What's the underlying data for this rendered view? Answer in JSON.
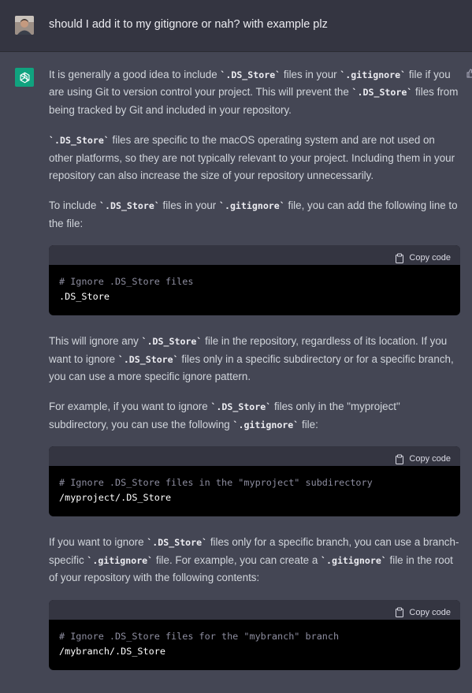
{
  "user": {
    "avatar_icon": "user-avatar",
    "message": "should I add it to my gitignore or nah? with example plz"
  },
  "assistant": {
    "logo_icon": "openai-logo",
    "p1": {
      "a": "It is generally a good idea to include ",
      "c1": "`.DS_Store`",
      "b": " files in your ",
      "c2": "`.gitignore`",
      "c": " file if you are using Git to version control your project. This will prevent the ",
      "c3": "`.DS_Store`",
      "d": " files from being tracked by Git and included in your repository."
    },
    "p2": {
      "c1": "`.DS_Store`",
      "a": " files are specific to the macOS operating system and are not used on other platforms, so they are not typically relevant to your project. Including them in your repository can also increase the size of your repository unnecessarily."
    },
    "p3": {
      "a": "To include ",
      "c1": "`.DS_Store`",
      "b": " files in your ",
      "c2": "`.gitignore`",
      "c": " file, you can add the following line to the file:"
    },
    "code1": {
      "copy_label": "Copy code",
      "comment": "# Ignore .DS_Store files",
      "line": ".DS_Store"
    },
    "p4": {
      "a": "This will ignore any ",
      "c1": "`.DS_Store`",
      "b": " file in the repository, regardless of its location. If you want to ignore ",
      "c2": "`.DS_Store`",
      "c": " files only in a specific subdirectory or for a specific branch, you can use a more specific ignore pattern."
    },
    "p5": {
      "a": "For example, if you want to ignore ",
      "c1": "`.DS_Store`",
      "b": " files only in the \"myproject\" subdirectory, you can use the following ",
      "c2": "`.gitignore`",
      "c": " file:"
    },
    "code2": {
      "copy_label": "Copy code",
      "comment": "# Ignore .DS_Store files in the \"myproject\" subdirectory",
      "line": "/myproject/.DS_Store"
    },
    "p6": {
      "a": "If you want to ignore ",
      "c1": "`.DS_Store`",
      "b": " files only for a specific branch, you can use a branch-specific ",
      "c2": "`.gitignore`",
      "c": " file. For example, you can create a ",
      "c3": "`.gitignore`",
      "d": " file in the root of your repository with the following contents:"
    },
    "code3": {
      "copy_label": "Copy code",
      "comment": "# Ignore .DS_Store files for the \"mybranch\" branch",
      "line": "/mybranch/.DS_Store"
    }
  }
}
